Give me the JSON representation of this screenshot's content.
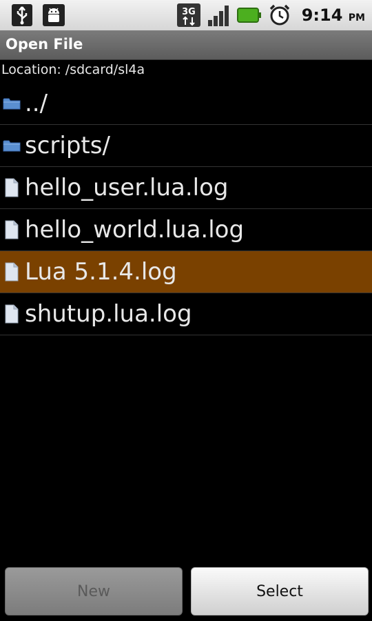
{
  "status_bar": {
    "icons_left": [
      "usb-icon",
      "android-debug-icon"
    ],
    "network": "3G",
    "icons_right": [
      "3g-data-icon",
      "signal-icon",
      "battery-icon",
      "alarm-icon"
    ],
    "time": "9:14",
    "ampm": "PM"
  },
  "dialog": {
    "title": "Open File",
    "location": "Location: /sdcard/sl4a"
  },
  "files": [
    {
      "name": "../",
      "type": "folder",
      "icon": "folder-icon"
    },
    {
      "name": "scripts/",
      "type": "folder",
      "icon": "folder-icon"
    },
    {
      "name": "hello_user.lua.log",
      "type": "file",
      "icon": "file-icon"
    },
    {
      "name": "hello_world.lua.log",
      "type": "file",
      "icon": "file-icon"
    },
    {
      "name": "Lua 5.1.4.log",
      "type": "file",
      "icon": "file-icon",
      "selected": true
    },
    {
      "name": "shutup.lua.log",
      "type": "file",
      "icon": "file-icon"
    }
  ],
  "buttons": {
    "new_label": "New",
    "select_label": "Select"
  },
  "colors": {
    "selection": "#7a4100",
    "background": "#000000"
  }
}
